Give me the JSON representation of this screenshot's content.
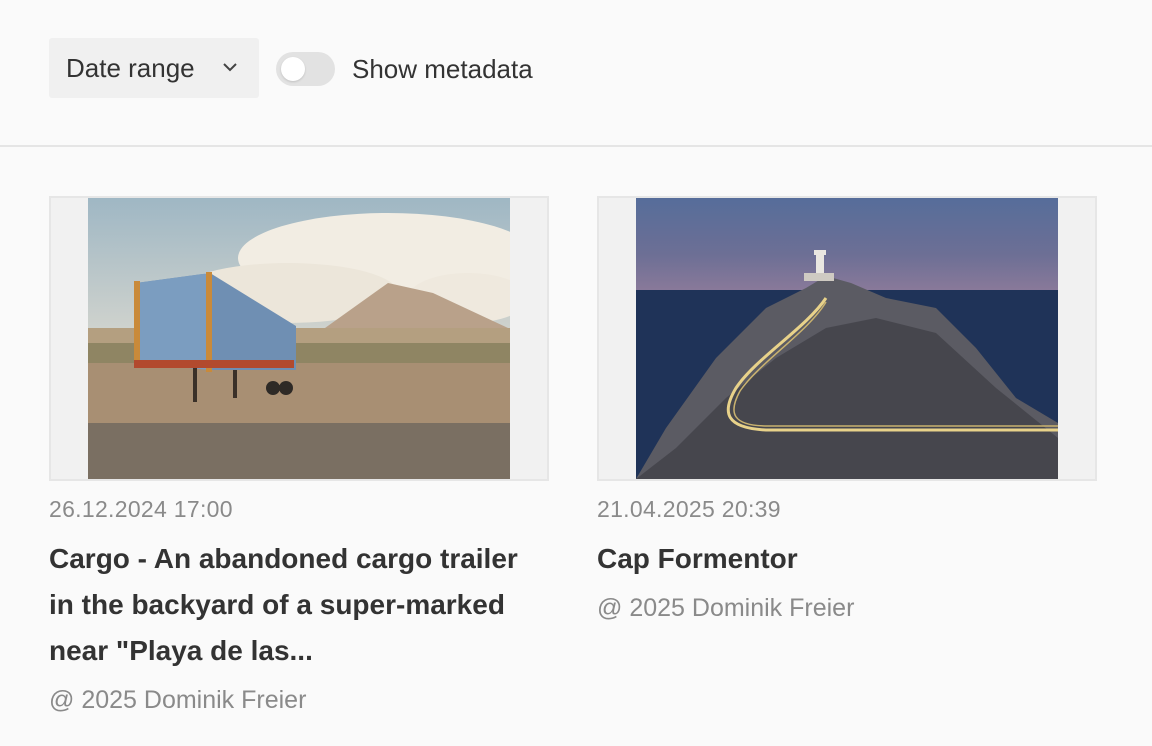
{
  "toolbar": {
    "date_range_label": "Date range",
    "show_metadata_label": "Show metadata",
    "show_metadata_on": false
  },
  "cards": [
    {
      "date": "26.12.2024 17:00",
      "title": "Cargo - An abandoned cargo trailer in the backyard of a super-marked near \"Playa de las...",
      "credit": "@ 2025 Dominik Freier"
    },
    {
      "date": "21.04.2025 20:39",
      "title": "Cap Formentor",
      "credit": "@ 2025 Dominik Freier"
    }
  ],
  "colors": {
    "background": "#fafafa",
    "muted_text": "#8a8a8a",
    "text": "#333333",
    "toggle_off": "#e2e2e2"
  }
}
